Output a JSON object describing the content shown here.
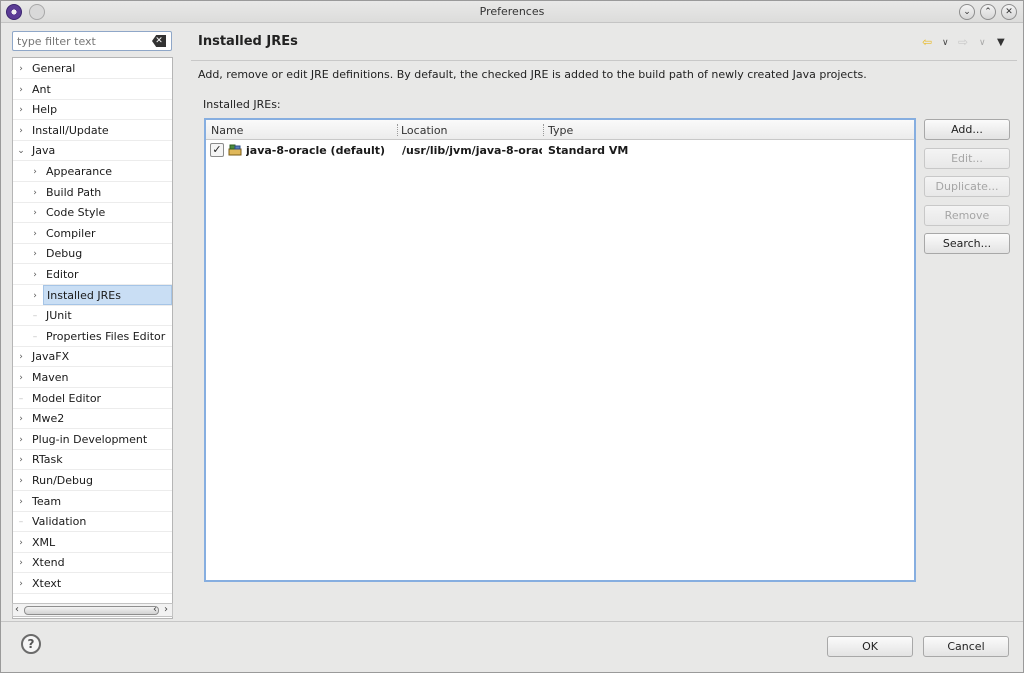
{
  "window": {
    "title": "Preferences"
  },
  "filter": {
    "placeholder": "type filter text"
  },
  "tree": [
    {
      "label": "General",
      "level": 0,
      "expandable": true
    },
    {
      "label": "Ant",
      "level": 0,
      "expandable": true
    },
    {
      "label": "Help",
      "level": 0,
      "expandable": true
    },
    {
      "label": "Install/Update",
      "level": 0,
      "expandable": true
    },
    {
      "label": "Java",
      "level": 0,
      "expandable": true,
      "expanded": true
    },
    {
      "label": "Appearance",
      "level": 1,
      "expandable": true
    },
    {
      "label": "Build Path",
      "level": 1,
      "expandable": true
    },
    {
      "label": "Code Style",
      "level": 1,
      "expandable": true
    },
    {
      "label": "Compiler",
      "level": 1,
      "expandable": true
    },
    {
      "label": "Debug",
      "level": 1,
      "expandable": true
    },
    {
      "label": "Editor",
      "level": 1,
      "expandable": true
    },
    {
      "label": "Installed JREs",
      "level": 1,
      "expandable": true,
      "selected": true
    },
    {
      "label": "JUnit",
      "level": 1,
      "expandable": false
    },
    {
      "label": "Properties Files Editor",
      "level": 1,
      "expandable": false
    },
    {
      "label": "JavaFX",
      "level": 0,
      "expandable": true
    },
    {
      "label": "Maven",
      "level": 0,
      "expandable": true
    },
    {
      "label": "Model Editor",
      "level": 0,
      "expandable": false
    },
    {
      "label": "Mwe2",
      "level": 0,
      "expandable": true
    },
    {
      "label": "Plug-in Development",
      "level": 0,
      "expandable": true
    },
    {
      "label": "RTask",
      "level": 0,
      "expandable": true
    },
    {
      "label": "Run/Debug",
      "level": 0,
      "expandable": true
    },
    {
      "label": "Team",
      "level": 0,
      "expandable": true
    },
    {
      "label": "Validation",
      "level": 0,
      "expandable": false
    },
    {
      "label": "XML",
      "level": 0,
      "expandable": true
    },
    {
      "label": "Xtend",
      "level": 0,
      "expandable": true
    },
    {
      "label": "Xtext",
      "level": 0,
      "expandable": true
    }
  ],
  "page": {
    "title": "Installed JREs",
    "description": "Add, remove or edit JRE definitions. By default, the checked JRE is added to the build path of newly created Java projects.",
    "group_label": "Installed JREs:"
  },
  "table": {
    "columns": [
      "Name",
      "Location",
      "Type"
    ],
    "rows": [
      {
        "checked": true,
        "name": "java-8-oracle (default)",
        "location": "/usr/lib/jvm/java-8-orac",
        "type": "Standard VM"
      }
    ]
  },
  "buttons": {
    "add": "Add...",
    "edit": "Edit...",
    "duplicate": "Duplicate...",
    "remove": "Remove",
    "search": "Search...",
    "ok": "OK",
    "cancel": "Cancel"
  },
  "colors": {
    "selection": "#c9def4",
    "table_border": "#86aee0",
    "nav_arrow": "#e8b923"
  }
}
